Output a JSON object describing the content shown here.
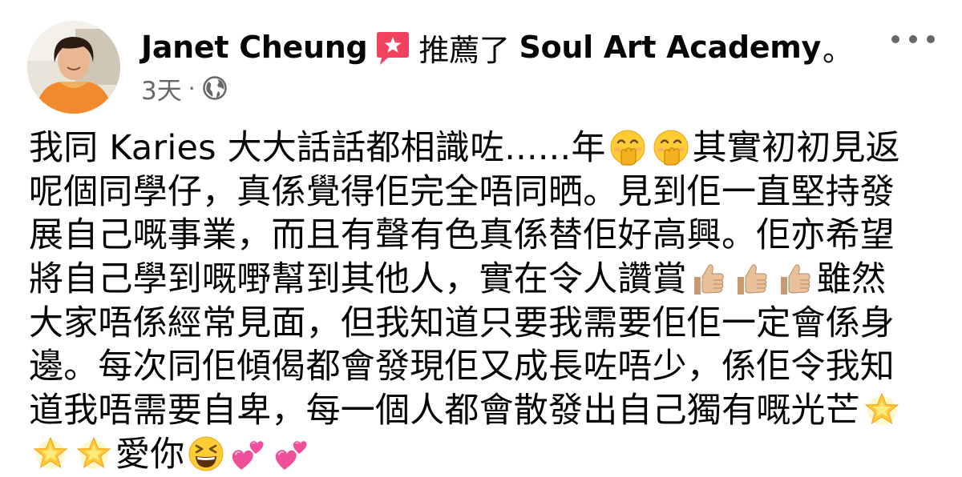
{
  "post": {
    "author_name": "Janet Cheung",
    "action_text": "推薦了",
    "page_name": "Soul Art Academy",
    "period": "。",
    "timestamp": "3天",
    "meta_separator": "·",
    "privacy_icon": "globe-icon",
    "recommend_icon": "recommend-star-badge-icon",
    "more_icon": "more-options-icon",
    "body_lines": [
      [
        "我同 Karies 大大話話都相識咗......年",
        "其實初初見返"
      ],
      [
        "呢個同學仔，真係覺得佢完全唔同晒。見到佢一直堅持發"
      ],
      [
        "展自己嘅事業，而且有聲有色真係替佢好高興。佢亦希望"
      ],
      [
        "將自己學到嘅嘢幫到其他人，實在令人讚賞",
        "雖然"
      ],
      [
        "大家唔係經常見面，但我知道只要我需要佢佢一定會係身"
      ],
      [
        "邊。每次同佢傾偈都會發現佢又成長咗唔少，係佢令我知"
      ],
      [
        "道我唔需要自卑，每一個人都會散發出自己獨有嘅光芒"
      ],
      [
        "愛你"
      ]
    ],
    "emoji_names": {
      "hand_over_mouth": "face-with-hand-over-mouth-emoji",
      "thumbs_up": "thumbs-up-emoji",
      "glowing_star": "glowing-star-emoji",
      "grinning_squint": "grinning-squinting-face-emoji",
      "two_hearts": "two-hearts-emoji"
    }
  },
  "colors": {
    "text_primary": "#050505",
    "text_secondary": "#65676b",
    "recommend_badge": "#f3425f"
  }
}
